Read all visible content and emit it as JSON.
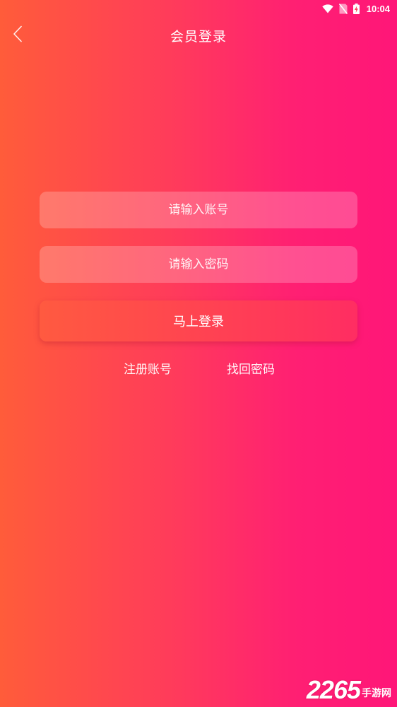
{
  "status_bar": {
    "time": "10:04",
    "icons": [
      "wifi-icon",
      "no-sim-icon",
      "battery-charging-icon"
    ]
  },
  "header": {
    "back_icon": "chevron-left-icon",
    "title": "会员登录"
  },
  "form": {
    "account_placeholder": "请输入账号",
    "password_placeholder": "请输入密码",
    "login_label": "马上登录"
  },
  "links": {
    "register": "注册账号",
    "recover": "找回密码"
  },
  "watermark": {
    "digits": "2265",
    "text": "手游网"
  },
  "colors": {
    "gradient_start": "#ff5c3a",
    "gradient_end": "#ff1678"
  }
}
